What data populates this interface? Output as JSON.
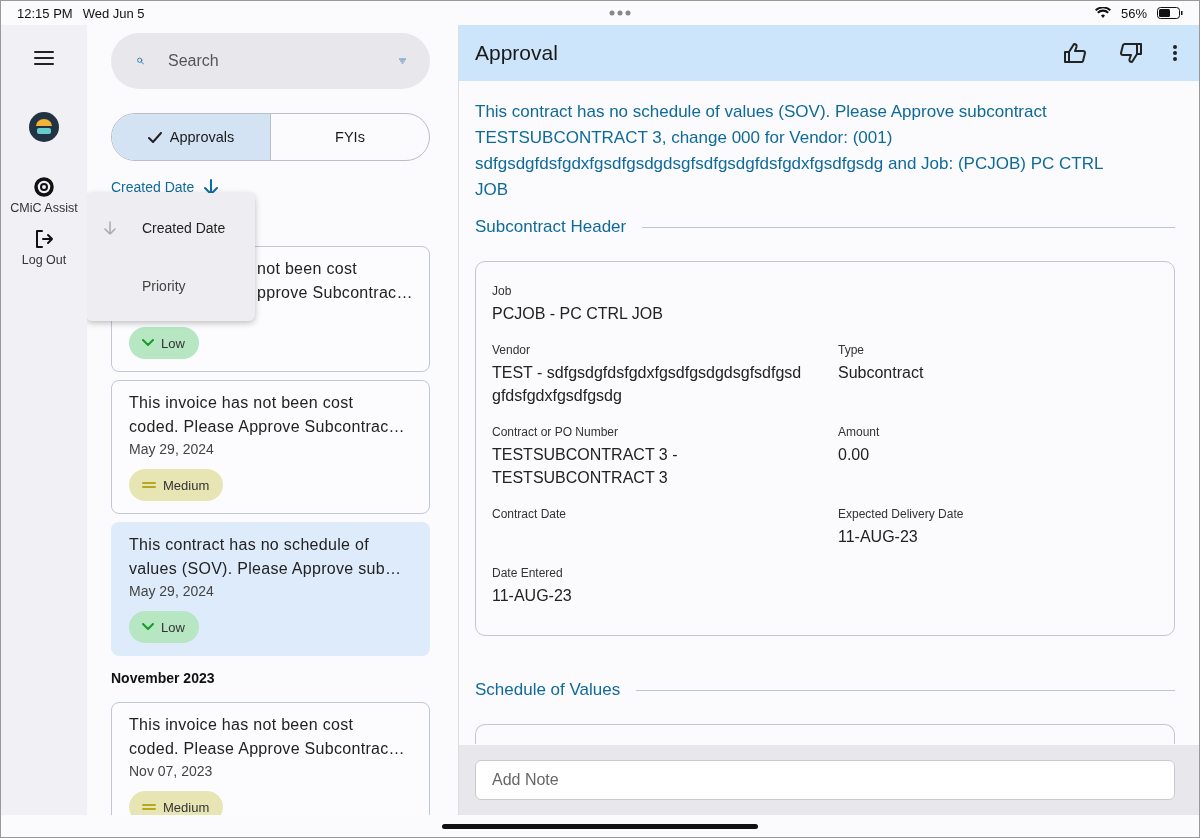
{
  "status_bar": {
    "time": "12:15 PM",
    "date": "Wed Jun 5",
    "battery": "56%"
  },
  "rail": {
    "items": [
      {
        "kind": "menu"
      },
      {
        "kind": "avatar"
      },
      {
        "kind": "assist",
        "label": "CMiC Assist"
      },
      {
        "kind": "logout",
        "label": "Log Out"
      }
    ]
  },
  "search": {
    "placeholder": "Search"
  },
  "tabs": [
    {
      "label": "Approvals",
      "selected": true
    },
    {
      "label": "FYIs",
      "selected": false
    }
  ],
  "sort": {
    "label": "Created Date"
  },
  "sort_menu": [
    {
      "label": "Created Date",
      "selected": true
    },
    {
      "label": "Priority",
      "selected": false
    }
  ],
  "groups": [
    {
      "cards": [
        {
          "lines": [
            "not been cost",
            "pprove Subcontrac…"
          ],
          "covered": true,
          "priority": "Low",
          "kind": "low",
          "selected": false
        },
        {
          "lines": [
            "This invoice has not been cost",
            "coded. Please Approve Subcontrac…"
          ],
          "date": "May 29, 2024",
          "priority": "Medium",
          "kind": "medium",
          "selected": false
        },
        {
          "lines": [
            "This contract has no schedule of",
            "values (SOV).  Please Approve sub…"
          ],
          "date": "May 29, 2024",
          "priority": "Low",
          "kind": "low",
          "selected": true
        }
      ]
    },
    {
      "heading": "November 2023",
      "cards": [
        {
          "lines": [
            "This invoice has not been cost",
            "coded. Please Approve Subcontrac…"
          ],
          "date": "Nov 07, 2023",
          "priority": "Medium",
          "kind": "medium",
          "selected": false
        }
      ]
    }
  ],
  "detail": {
    "title": "Approval",
    "message": "This contract has no schedule of values (SOV). Please Approve subcontract TESTSUBCONTRACT 3, change 000 for Vendor: (001) sdfgsdgfdsfgdxfgsdfgsdgdsgfsdfgsdgfdsfgdxfgsdfgsdg and Job: (PCJOB) PC CTRL JOB",
    "sections": [
      {
        "title": "Subcontract Header",
        "fields": [
          {
            "label": "Job",
            "value": "PCJOB - PC CTRL JOB",
            "wide": true
          },
          {
            "label": "Vendor",
            "value": "TEST - sdfgsdgfdsfgdxfgsdfgsdgdsgfsdfgsd gfdsfgdxfgsdfgsdg"
          },
          {
            "label": "Type",
            "value": "Subcontract"
          },
          {
            "label": "Contract or PO Number",
            "value": "TESTSUBCONTRACT 3 - TESTSUBCONTRACT 3"
          },
          {
            "label": "Amount",
            "value": "0.00"
          },
          {
            "label": "Contract Date"
          },
          {
            "label": "Expected Delivery Date",
            "value": "11-AUG-23"
          },
          {
            "label": "Date Entered",
            "value": "11-AUG-23"
          }
        ]
      },
      {
        "title": "Schedule of Values"
      }
    ],
    "note": {
      "placeholder": "Add Note"
    }
  }
}
